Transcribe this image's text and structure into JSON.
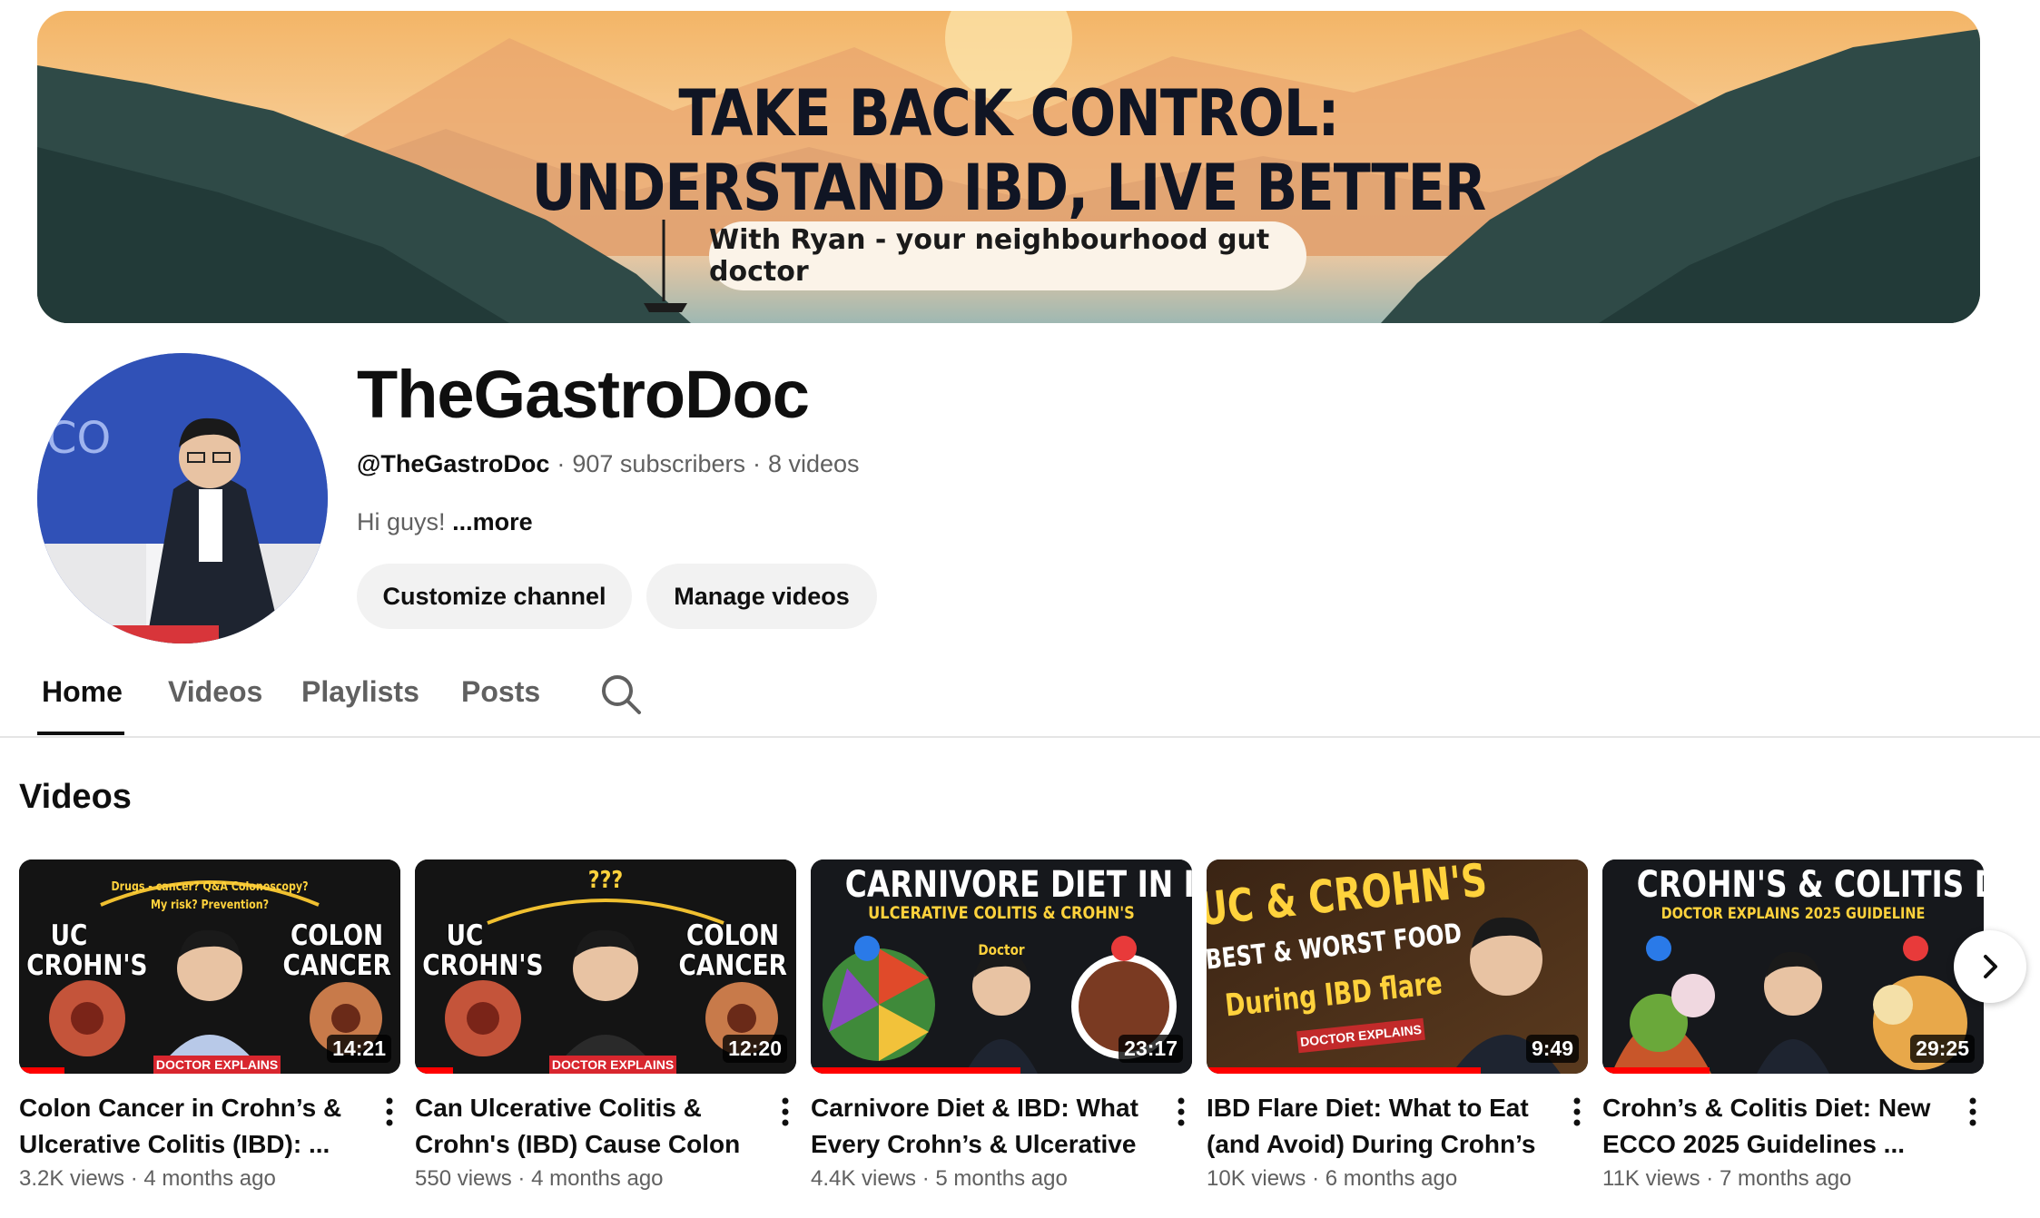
{
  "banner": {
    "title_line1": "TAKE BACK CONTROL:",
    "title_line2": "UNDERSTAND IBD, LIVE BETTER",
    "tagline": "With Ryan - your neighbourhood gut doctor"
  },
  "channel": {
    "name": "TheGastroDoc",
    "handle": "@TheGastroDoc",
    "subscribers": "907 subscribers",
    "video_count": "8 videos",
    "separator": "·",
    "description": "Hi guys!",
    "more_label": "...more",
    "customize_label": "Customize channel",
    "manage_label": "Manage videos"
  },
  "tabs": [
    {
      "label": "Home",
      "active": true
    },
    {
      "label": "Videos",
      "active": false
    },
    {
      "label": "Playlists",
      "active": false
    },
    {
      "label": "Posts",
      "active": false
    }
  ],
  "section": {
    "title": "Videos"
  },
  "videos": [
    {
      "thumb_top": "Drugs - cancer?  Q&A  Colonoscopy?",
      "thumb_sub": "My risk?   Prevention?",
      "thumb_left": "UC\nCROHN'S",
      "thumb_right": "COLON\nCANCER",
      "thumb_tag": "DOCTOR EXPLAINS",
      "duration": "14:21",
      "progress": 0.12,
      "title": "Colon Cancer in Crohn’s & Ulcerative Colitis (IBD): ...",
      "views": "3.2K views",
      "age": "4 months ago"
    },
    {
      "thumb_top": "???",
      "thumb_left": "UC\nCROHN'S",
      "thumb_right": "COLON\nCANCER",
      "thumb_tag": "DOCTOR EXPLAINS",
      "duration": "12:20",
      "progress": 0.1,
      "title": "Can Ulcerative Colitis & Crohn's (IBD) Cause Colon ...",
      "views": "550 views",
      "age": "4 months ago"
    },
    {
      "thumb_top": "CARNIVORE DIET IN IBD",
      "thumb_sub": "ULCERATIVE COLITIS & CROHN'S",
      "thumb_mid": "Doctor",
      "duration": "23:17",
      "progress": 0.55,
      "title": "Carnivore Diet & IBD: What Every Crohn’s & Ulcerative ...",
      "views": "4.4K views",
      "age": "5 months ago"
    },
    {
      "thumb_top": "UC & CROHN'S",
      "thumb_sub": "BEST & WORST FOOD",
      "thumb_mid": "During IBD flare",
      "thumb_tag": "DOCTOR EXPLAINS",
      "duration": "9:49",
      "progress": 0.72,
      "title": "IBD Flare Diet: What to Eat (and Avoid) During Crohn’s ...",
      "views": "10K views",
      "age": "6 months ago"
    },
    {
      "thumb_top": "CROHN'S & COLITIS DIET",
      "thumb_sub": "DOCTOR EXPLAINS 2025 GUIDELINE",
      "duration": "29:25",
      "progress": 0.28,
      "title": "Crohn’s & Colitis Diet: New ECCO 2025 Guidelines ...",
      "views": "11K views",
      "age": "7 months ago"
    }
  ],
  "colors": {
    "accent_red": "#ff0000",
    "button_bg": "#f2f2f2",
    "muted_text": "#606060"
  },
  "icons": {
    "search": "search-icon",
    "kebab": "more-vert-icon",
    "next": "chevron-right-icon"
  }
}
